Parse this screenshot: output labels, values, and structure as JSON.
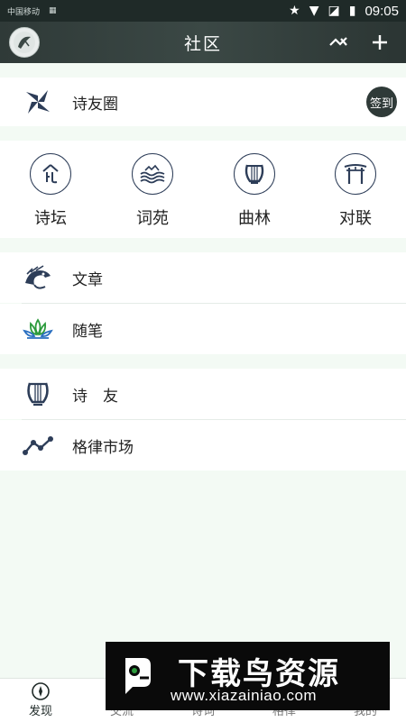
{
  "status_bar": {
    "carrier": "中国移动",
    "time": "09:05"
  },
  "header": {
    "title": "社区",
    "trend_icon": "trend-icon",
    "add_icon": "plus-icon"
  },
  "feed": {
    "label": "诗友圈",
    "checkin_label": "签到"
  },
  "categories": [
    {
      "label": "诗坛",
      "icon": "poem-altar-icon"
    },
    {
      "label": "词苑",
      "icon": "waves-icon"
    },
    {
      "label": "曲林",
      "icon": "lyre-icon"
    },
    {
      "label": "对联",
      "icon": "gate-icon"
    }
  ],
  "list_a": [
    {
      "label": "文章",
      "icon": "dragon-icon"
    },
    {
      "label": "随笔",
      "icon": "lotus-icon"
    }
  ],
  "list_b": [
    {
      "label": "诗　友",
      "icon": "lyre-icon"
    },
    {
      "label": "格律市场",
      "icon": "line-chart-icon"
    }
  ],
  "bottom_nav": [
    {
      "label": "发现",
      "active": true
    },
    {
      "label": "交流",
      "active": false
    },
    {
      "label": "诗词",
      "active": false
    },
    {
      "label": "格律",
      "active": false
    },
    {
      "label": "我的",
      "active": false
    }
  ],
  "watermark": {
    "title": "下载鸟资源",
    "url": "www.xiazainiao.com"
  },
  "colors": {
    "accent": "#2f3a38",
    "icon_blue": "#2d3d58",
    "green": "#2c9b3c",
    "background": "#f3faf4"
  }
}
